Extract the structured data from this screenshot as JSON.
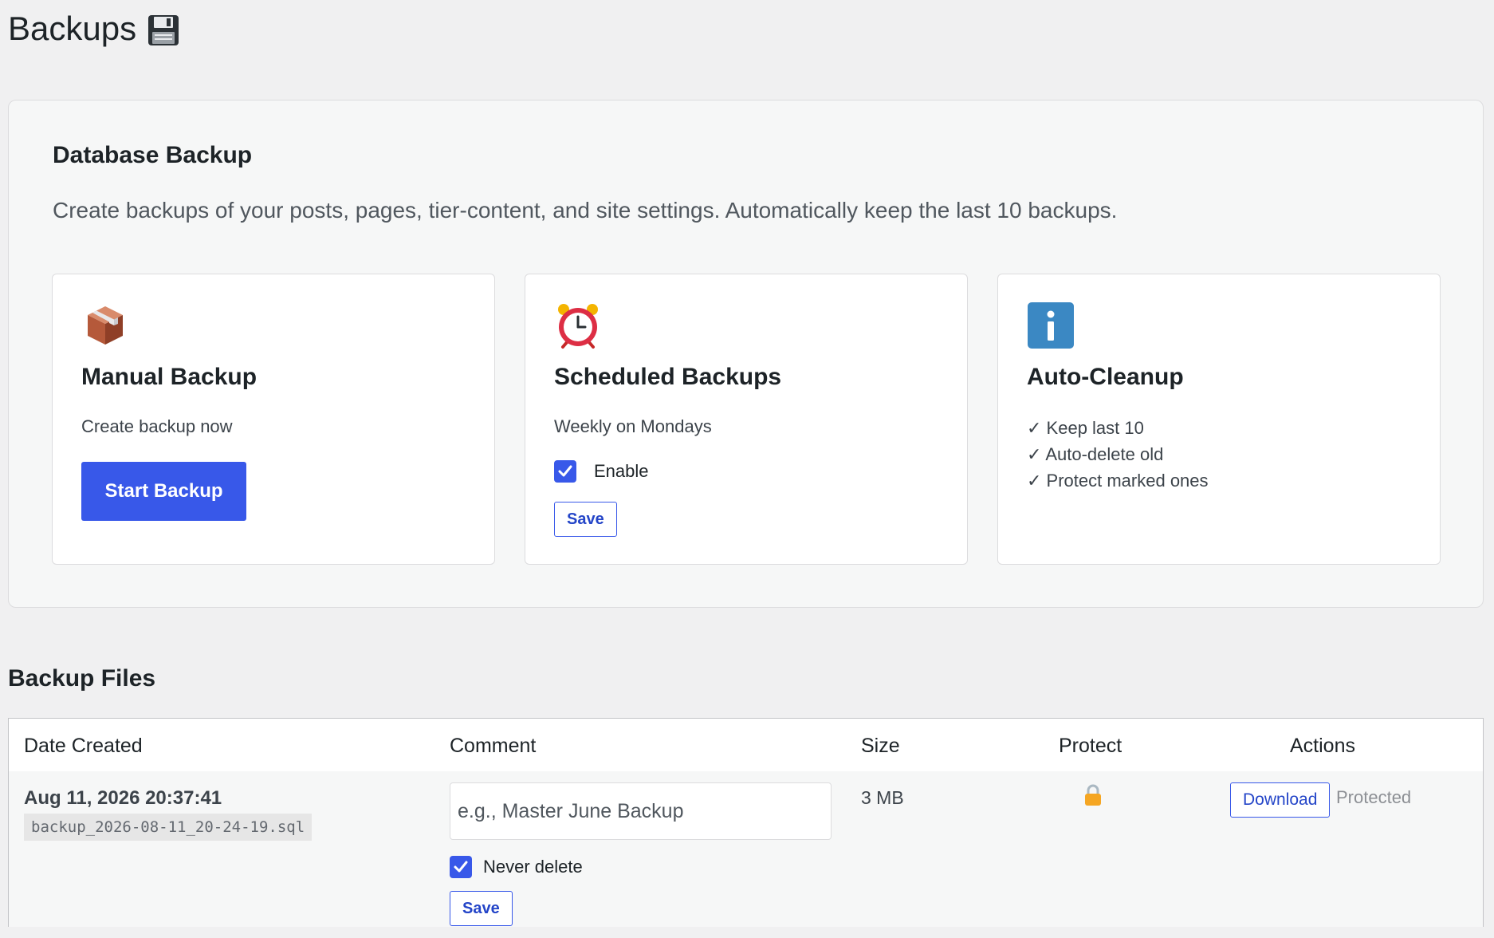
{
  "page": {
    "title": "Backups",
    "title_icon": "floppy-disk-icon"
  },
  "panel": {
    "title": "Database Backup",
    "description": "Create backups of your posts, pages, tier-content, and site settings. Automatically keep the last 10 backups."
  },
  "cards": {
    "manual": {
      "icon": "package-icon",
      "title": "Manual Backup",
      "subtitle": "Create backup now",
      "button_label": "Start Backup"
    },
    "scheduled": {
      "icon": "alarm-clock-icon",
      "title": "Scheduled Backups",
      "subtitle": "Weekly on Mondays",
      "enable_label": "Enable",
      "enabled": true,
      "save_label": "Save"
    },
    "cleanup": {
      "icon": "info-icon",
      "title": "Auto-Cleanup",
      "items": [
        "✓ Keep last 10",
        "✓ Auto-delete old",
        "✓ Protect marked ones"
      ]
    }
  },
  "files": {
    "section_title": "Backup Files",
    "columns": [
      "Date Created",
      "Comment",
      "Size",
      "Protect",
      "Actions"
    ],
    "rows": [
      {
        "date": "Aug 11, 2026 20:37:41",
        "filename": "backup_2026-08-11_20-24-19.sql",
        "comment_placeholder": "e.g., Master June Backup",
        "never_delete_label": "Never delete",
        "never_delete": true,
        "save_label": "Save",
        "size": "3 MB",
        "protect_icon": "lock-icon",
        "download_label": "Download",
        "status": "Protected"
      }
    ]
  },
  "colors": {
    "accent": "#3858e9",
    "background": "#f0f0f1",
    "lock": "#f5a623",
    "info": "#3b88c3"
  }
}
